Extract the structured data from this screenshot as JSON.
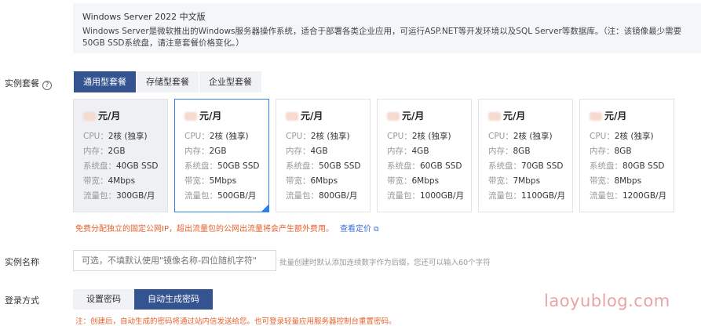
{
  "image_info": {
    "title": "Windows Server 2022 中文版",
    "description": "Windows Server是微软推出的Windows服务器操作系统，适合于部署各类企业应用，可运行ASP.NET等开发环境以及SQL Server等数据库。（注：该镜像最少需要50GB SSD系统盘，请注意套餐价格变化。）"
  },
  "instance_package": {
    "label": "实例套餐",
    "help_icon": "?",
    "tabs": [
      "通用型套餐",
      "存储型套餐",
      "企业型套餐"
    ],
    "active_tab": 0,
    "unit": "元/月",
    "spec_keys": {
      "cpu": "CPU：",
      "mem": "内存：",
      "disk": "系统盘：",
      "bw": "带宽：",
      "traffic": "流量包："
    },
    "cards": [
      {
        "cpu": "2核 (独享)",
        "mem": "2GB",
        "disk": "40GB SSD",
        "bw": "4Mbps",
        "traffic": "300GB/月",
        "state": "disabled"
      },
      {
        "cpu": "2核 (独享)",
        "mem": "2GB",
        "disk": "50GB SSD",
        "bw": "5Mbps",
        "traffic": "500GB/月",
        "state": "selected"
      },
      {
        "cpu": "2核 (独享)",
        "mem": "4GB",
        "disk": "50GB SSD",
        "bw": "6Mbps",
        "traffic": "800GB/月",
        "state": "normal"
      },
      {
        "cpu": "2核 (独享)",
        "mem": "4GB",
        "disk": "60GB SSD",
        "bw": "6Mbps",
        "traffic": "1000GB/月",
        "state": "normal"
      },
      {
        "cpu": "2核 (独享)",
        "mem": "8GB",
        "disk": "70GB SSD",
        "bw": "7Mbps",
        "traffic": "1100GB/月",
        "state": "normal"
      },
      {
        "cpu": "2核 (独享)",
        "mem": "8GB",
        "disk": "80GB SSD",
        "bw": "8Mbps",
        "traffic": "1200GB/月",
        "state": "normal"
      }
    ],
    "note": "免费分配独立的固定公网IP，超出流量包的公网出流量将会产生额外费用。",
    "pricing_link": "查看定价"
  },
  "instance_name": {
    "label": "实例名称",
    "placeholder": "可选，不填默认使用\"镜像名称-四位随机字符\"",
    "hint": "批量创建时默认添加连续数字作为后缀，您还可以输入60个字符"
  },
  "login": {
    "label": "登录方式",
    "options": [
      "设置密码",
      "自动生成密码"
    ],
    "active": 1,
    "note": "注：创建后，自动生成的密码将通过站内信发送给您。也可登录轻量应用服务器控制台重置密码。"
  },
  "watermark": "laoyublog.com",
  "colors": {
    "accent": "#345391",
    "selected_border": "#2f7ff0",
    "warning": "#e4622f",
    "link": "#3b6ed5"
  }
}
